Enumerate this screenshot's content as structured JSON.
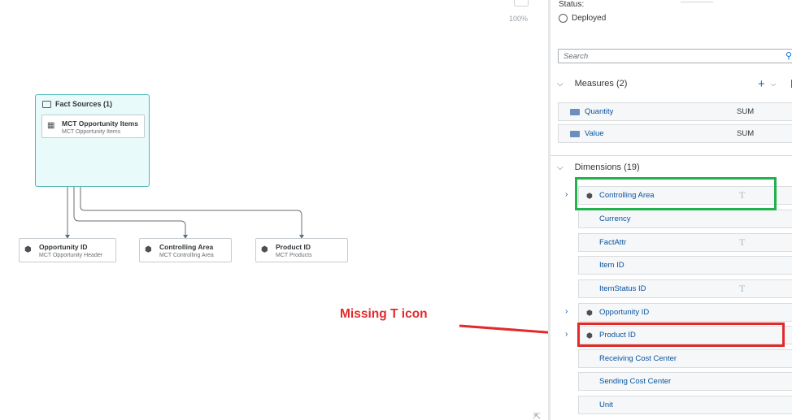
{
  "canvas": {
    "zoom_label": "100%",
    "fact_sources": {
      "header": "Fact Sources (1)",
      "item": {
        "title": "MCT Opportunity Items",
        "subtitle": "MCT Opportunity Items"
      }
    },
    "nodes": [
      {
        "title": "Opportunity ID",
        "subtitle": "MCT Opportunity Header"
      },
      {
        "title": "Controlling Area",
        "subtitle": "MCT Controlling Area"
      },
      {
        "title": "Product ID",
        "subtitle": "MCT Products"
      }
    ],
    "annotation": "Missing T icon"
  },
  "panel": {
    "status_label": "Status:",
    "status_value": "Deployed",
    "search_placeholder": "Search",
    "measures": {
      "header": "Measures (2)",
      "items": [
        {
          "label": "Quantity",
          "aggregation": "SUM"
        },
        {
          "label": "Value",
          "aggregation": "SUM"
        }
      ]
    },
    "dimensions": {
      "header": "Dimensions (19)",
      "items": [
        {
          "label": "Controlling Area",
          "expandable": true,
          "t_icon": "T"
        },
        {
          "label": "Currency"
        },
        {
          "label": "FactAttr",
          "t_icon": "T"
        },
        {
          "label": "Item ID"
        },
        {
          "label": "ItemStatus ID",
          "t_icon": "T"
        },
        {
          "label": "Opportunity ID",
          "expandable": true
        },
        {
          "label": "Product ID",
          "expandable": true
        },
        {
          "label": "Receiving Cost Center"
        },
        {
          "label": "Sending Cost Center"
        },
        {
          "label": "Unit"
        }
      ]
    }
  },
  "colors": {
    "accent": "#0a6ed1",
    "link": "#0854a0",
    "fact_bg": "#e8fafa",
    "fact_border": "#4fb6b6",
    "highlight_green": "#22b24c",
    "highlight_red": "#e32a2a"
  },
  "icons": [
    "folder-icon",
    "table-icon",
    "cube-icon",
    "clock-icon",
    "search-icon",
    "plus-icon",
    "chevron-down-icon",
    "chevron-right-icon",
    "measure-icon",
    "text-type-icon",
    "resize-icon"
  ]
}
